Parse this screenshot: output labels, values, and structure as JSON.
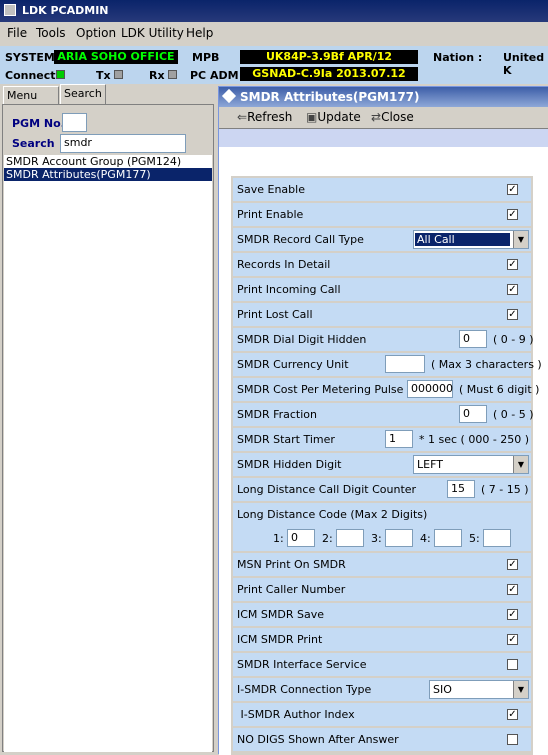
{
  "app": {
    "title": "LDK PCADMIN"
  },
  "menu": [
    "File",
    "Tools",
    "Option",
    "LDK Utility",
    "Help"
  ],
  "status": {
    "system_label": "SYSTEM",
    "system_value": "ARIA SOHO OFFICE",
    "mpb_label": "MPB",
    "mpb_value": "UK84P-3.9Bf APR/12",
    "nation_label": "Nation :",
    "nation_value": "United K",
    "connect_label": "Connect",
    "tx_label": "Tx",
    "rx_label": "Rx",
    "pcadm_label": "PC ADM",
    "pcadm_value": "GSNAD-C.9Ia 2013.07.12",
    "colors": {
      "system_value": "#00ff00",
      "mpb_value": "#ffff00",
      "pcadm_value": "#ffff00",
      "connect_led": "#00cc00"
    }
  },
  "left": {
    "tabs": [
      "Menu List",
      "Search"
    ],
    "pgm_label": "PGM No.",
    "pgm_value": "",
    "search_label": "Search",
    "search_value": "smdr",
    "results": [
      "SMDR Account Group (PGM124)",
      "SMDR Attributes(PGM177)"
    ],
    "selected_index": 1
  },
  "dialog": {
    "title": "SMDR Attributes(PGM177)",
    "toolbar": {
      "refresh": "Refresh",
      "update": "Update",
      "close": "Close"
    },
    "rows": {
      "save_enable": {
        "label": "Save Enable",
        "checked": true
      },
      "print_enable": {
        "label": "Print Enable",
        "checked": true
      },
      "record_call_type": {
        "label": "SMDR Record Call Type",
        "value": "All Call"
      },
      "records_in_detail": {
        "label": "Records In Detail",
        "checked": true
      },
      "print_incoming": {
        "label": "Print Incoming Call",
        "checked": true
      },
      "print_lost": {
        "label": "Print Lost Call",
        "checked": true
      },
      "dial_digit_hidden": {
        "label": "SMDR Dial Digit Hidden",
        "value": "0",
        "range": "( 0 - 9 )"
      },
      "currency_unit": {
        "label": "SMDR Currency Unit",
        "value": "",
        "range": "( Max 3 characters )"
      },
      "cost_pulse": {
        "label": "SMDR Cost Per Metering Pulse",
        "value": "000000",
        "range": "( Must 6 digit )"
      },
      "fraction": {
        "label": "SMDR Fraction",
        "value": "0",
        "range": "( 0 - 5 )"
      },
      "start_timer": {
        "label": "SMDR Start Timer",
        "value": "1",
        "range": "* 1 sec  ( 000 - 250 )"
      },
      "hidden_digit": {
        "label": "SMDR Hidden Digit",
        "value": "LEFT"
      },
      "ld_digit_counter": {
        "label": "Long Distance Call Digit Counter",
        "value": "15",
        "range": "( 7 - 15 )"
      },
      "ld_code": {
        "label": "Long Distance Code  (Max 2 Digits)",
        "codes": [
          {
            "label": "1:",
            "value": "0"
          },
          {
            "label": "2:",
            "value": ""
          },
          {
            "label": "3:",
            "value": ""
          },
          {
            "label": "4:",
            "value": ""
          },
          {
            "label": "5:",
            "value": ""
          }
        ]
      },
      "msn_print": {
        "label": "MSN Print On SMDR",
        "checked": true
      },
      "print_caller": {
        "label": "Print Caller Number",
        "checked": true
      },
      "icm_save": {
        "label": "ICM SMDR Save",
        "checked": true
      },
      "icm_print": {
        "label": "ICM SMDR Print",
        "checked": true
      },
      "interface_service": {
        "label": "SMDR Interface Service",
        "checked": false
      },
      "connection_type": {
        "label": "I-SMDR Connection Type",
        "value": "SIO"
      },
      "author_index": {
        "label": " I-SMDR Author Index",
        "checked": true
      },
      "no_digs": {
        "label": "NO DIGS Shown After Answer",
        "checked": false
      }
    }
  }
}
